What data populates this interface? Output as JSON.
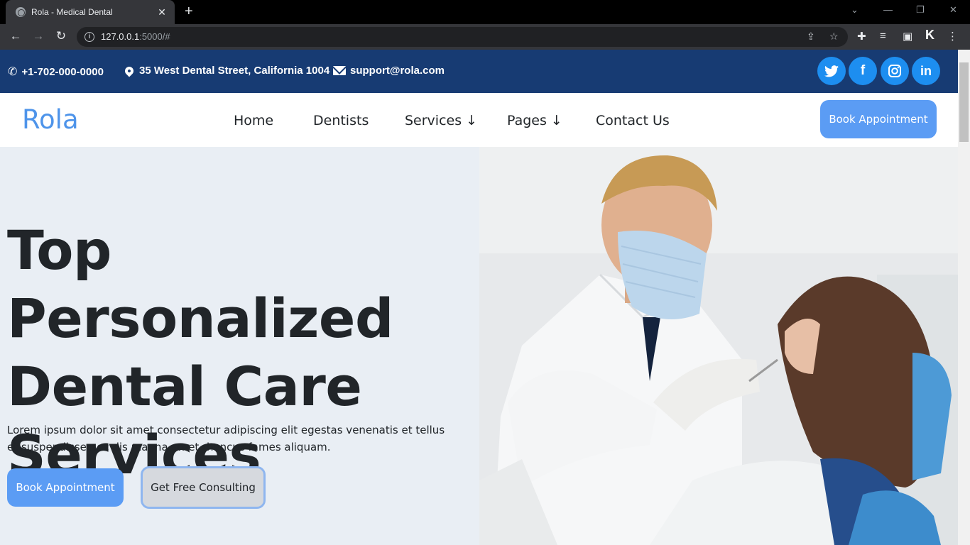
{
  "browser": {
    "tab_title": "Rola - Medical Dental",
    "tab_close": "✕",
    "new_tab": "+",
    "url_host": "127.0.0.1",
    "url_rest": ":5000/#"
  },
  "topbar": {
    "phone": "+1-702-000-0000",
    "address": "35 West Dental Street, California 1004",
    "email": "support@rola.com",
    "social": [
      "twitter",
      "facebook",
      "instagram",
      "linkedin"
    ]
  },
  "header": {
    "logo": "Rola",
    "nav": [
      "Home",
      "Dentists",
      "Services ↓",
      "Pages ↓",
      "Contact Us"
    ],
    "cta": "Book Appointment"
  },
  "hero": {
    "title_line1_light": "Top ",
    "title_line1_bold": "Personalized",
    "title_line2": "Dental Care",
    "title_line3": "Services",
    "text": "Lorem ipsum dolor sit amet consectetur adipiscing elit egestas venenatis et tellus et suspendisse nec dis magna amet rhoncus fames aliquam.",
    "primary_button": "Book Appointment",
    "secondary_button": "Get Free Consulting"
  },
  "colors": {
    "infobar": "#173b73",
    "accent": "#5b9cf4",
    "social": "#1d8ef0",
    "hero_bg": "#e9eef4"
  }
}
